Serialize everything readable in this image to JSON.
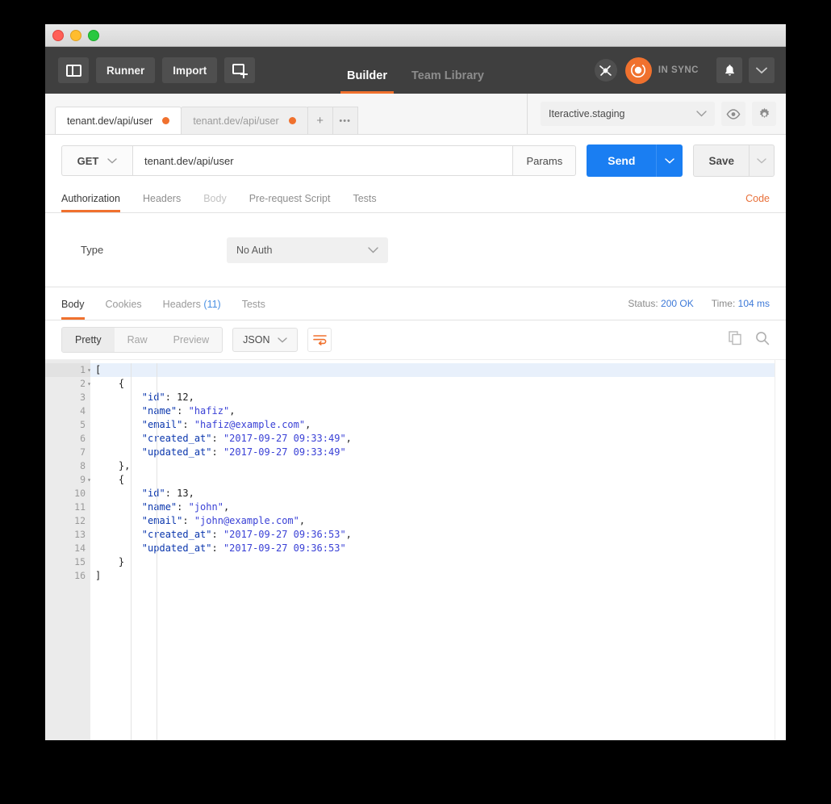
{
  "window": {
    "traffic_lights": [
      "close",
      "minimize",
      "zoom"
    ]
  },
  "toolbar": {
    "sidebar_toggle_icon": "sidebar-icon",
    "runner_label": "Runner",
    "import_label": "Import",
    "new_tab_icon": "new-window-icon",
    "main_tabs": [
      {
        "label": "Builder",
        "active": true
      },
      {
        "label": "Team Library",
        "active": false
      }
    ],
    "network_icon": "satellite-icon",
    "sync_icon": "sync-icon",
    "sync_status": "IN SYNC",
    "bell_icon": "bell-icon",
    "caret_icon": "chevron-down-icon"
  },
  "tabstrip": {
    "tabs": [
      {
        "label": "tenant.dev/api/user",
        "active": true,
        "unsaved": true
      },
      {
        "label": "tenant.dev/api/user",
        "active": false,
        "unsaved": true
      }
    ],
    "new_tab_label": "+",
    "more_label": "•••"
  },
  "environment": {
    "selected": "Iteractive.staging",
    "eye_icon": "eye-icon",
    "gear_icon": "gear-icon"
  },
  "request": {
    "method": "GET",
    "url": "tenant.dev/api/user",
    "params_label": "Params",
    "send_label": "Send",
    "save_label": "Save",
    "tabs": [
      {
        "label": "Authorization",
        "active": true,
        "disabled": false
      },
      {
        "label": "Headers",
        "active": false,
        "disabled": false
      },
      {
        "label": "Body",
        "active": false,
        "disabled": true
      },
      {
        "label": "Pre-request Script",
        "active": false,
        "disabled": false
      },
      {
        "label": "Tests",
        "active": false,
        "disabled": false
      }
    ],
    "code_link": "Code"
  },
  "auth": {
    "type_label": "Type",
    "type_value": "No Auth"
  },
  "response": {
    "tabs": [
      {
        "label": "Body",
        "count": "",
        "active": true
      },
      {
        "label": "Cookies",
        "count": "",
        "active": false
      },
      {
        "label": "Headers",
        "count": "(11)",
        "active": false
      },
      {
        "label": "Tests",
        "count": "",
        "active": false
      }
    ],
    "status_label": "Status:",
    "status_value": "200 OK",
    "time_label": "Time:",
    "time_value": "104 ms",
    "view_modes": [
      {
        "label": "Pretty",
        "active": true
      },
      {
        "label": "Raw",
        "active": false
      },
      {
        "label": "Preview",
        "active": false
      }
    ],
    "format": "JSON",
    "wrap_icon": "word-wrap-icon",
    "copy_icon": "copy-icon",
    "search_icon": "search-icon",
    "body_lines": [
      {
        "n": 1,
        "fold": true,
        "indent": 0,
        "tokens": [
          {
            "t": "punct",
            "v": "["
          }
        ]
      },
      {
        "n": 2,
        "fold": true,
        "indent": 1,
        "tokens": [
          {
            "t": "punct",
            "v": "{"
          }
        ]
      },
      {
        "n": 3,
        "fold": false,
        "indent": 2,
        "tokens": [
          {
            "t": "key",
            "v": "\"id\""
          },
          {
            "t": "punct",
            "v": ": "
          },
          {
            "t": "num",
            "v": "12"
          },
          {
            "t": "punct",
            "v": ","
          }
        ]
      },
      {
        "n": 4,
        "fold": false,
        "indent": 2,
        "tokens": [
          {
            "t": "key",
            "v": "\"name\""
          },
          {
            "t": "punct",
            "v": ": "
          },
          {
            "t": "str",
            "v": "\"hafiz\""
          },
          {
            "t": "punct",
            "v": ","
          }
        ]
      },
      {
        "n": 5,
        "fold": false,
        "indent": 2,
        "tokens": [
          {
            "t": "key",
            "v": "\"email\""
          },
          {
            "t": "punct",
            "v": ": "
          },
          {
            "t": "str",
            "v": "\"hafiz@example.com\""
          },
          {
            "t": "punct",
            "v": ","
          }
        ]
      },
      {
        "n": 6,
        "fold": false,
        "indent": 2,
        "tokens": [
          {
            "t": "key",
            "v": "\"created_at\""
          },
          {
            "t": "punct",
            "v": ": "
          },
          {
            "t": "str",
            "v": "\"2017-09-27 09:33:49\""
          },
          {
            "t": "punct",
            "v": ","
          }
        ]
      },
      {
        "n": 7,
        "fold": false,
        "indent": 2,
        "tokens": [
          {
            "t": "key",
            "v": "\"updated_at\""
          },
          {
            "t": "punct",
            "v": ": "
          },
          {
            "t": "str",
            "v": "\"2017-09-27 09:33:49\""
          }
        ]
      },
      {
        "n": 8,
        "fold": false,
        "indent": 1,
        "tokens": [
          {
            "t": "punct",
            "v": "},"
          }
        ]
      },
      {
        "n": 9,
        "fold": true,
        "indent": 1,
        "tokens": [
          {
            "t": "punct",
            "v": "{"
          }
        ]
      },
      {
        "n": 10,
        "fold": false,
        "indent": 2,
        "tokens": [
          {
            "t": "key",
            "v": "\"id\""
          },
          {
            "t": "punct",
            "v": ": "
          },
          {
            "t": "num",
            "v": "13"
          },
          {
            "t": "punct",
            "v": ","
          }
        ]
      },
      {
        "n": 11,
        "fold": false,
        "indent": 2,
        "tokens": [
          {
            "t": "key",
            "v": "\"name\""
          },
          {
            "t": "punct",
            "v": ": "
          },
          {
            "t": "str",
            "v": "\"john\""
          },
          {
            "t": "punct",
            "v": ","
          }
        ]
      },
      {
        "n": 12,
        "fold": false,
        "indent": 2,
        "tokens": [
          {
            "t": "key",
            "v": "\"email\""
          },
          {
            "t": "punct",
            "v": ": "
          },
          {
            "t": "str",
            "v": "\"john@example.com\""
          },
          {
            "t": "punct",
            "v": ","
          }
        ]
      },
      {
        "n": 13,
        "fold": false,
        "indent": 2,
        "tokens": [
          {
            "t": "key",
            "v": "\"created_at\""
          },
          {
            "t": "punct",
            "v": ": "
          },
          {
            "t": "str",
            "v": "\"2017-09-27 09:36:53\""
          },
          {
            "t": "punct",
            "v": ","
          }
        ]
      },
      {
        "n": 14,
        "fold": false,
        "indent": 2,
        "tokens": [
          {
            "t": "key",
            "v": "\"updated_at\""
          },
          {
            "t": "punct",
            "v": ": "
          },
          {
            "t": "str",
            "v": "\"2017-09-27 09:36:53\""
          }
        ]
      },
      {
        "n": 15,
        "fold": false,
        "indent": 1,
        "tokens": [
          {
            "t": "punct",
            "v": "}"
          }
        ]
      },
      {
        "n": 16,
        "fold": false,
        "indent": 0,
        "tokens": [
          {
            "t": "punct",
            "v": "]"
          }
        ]
      }
    ]
  },
  "colors": {
    "accent_orange": "#f0712e",
    "send_blue": "#1a7ef2",
    "dark_toolbar": "#3f3f3f",
    "link_blue": "#3d79d8"
  }
}
